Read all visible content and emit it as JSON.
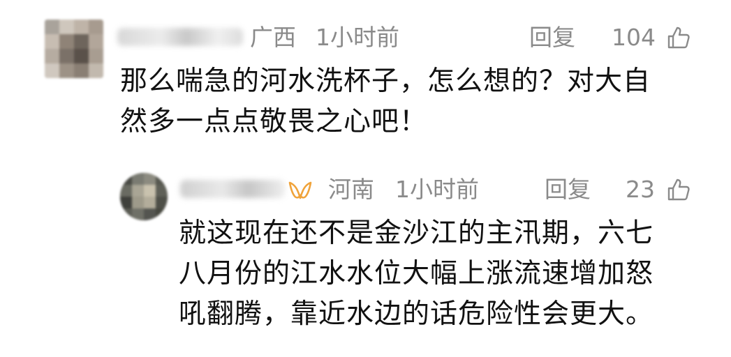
{
  "comments": {
    "main": {
      "location": "广西",
      "time": "1小时前",
      "reply_label": "回复",
      "likes": "104",
      "text_lines": [
        "那么喘急的河水洗杯子，怎么想的？对大自",
        "然多一点点敬畏之心吧！"
      ]
    },
    "reply": {
      "location": "河南",
      "time": "1小时前",
      "reply_label": "回复",
      "likes": "23",
      "text_lines": [
        "就这现在还不是金沙江的主汛期，六七",
        "八月份的江水水位大幅上涨流速增加怒",
        "吼翻腾，靠近水边的话危险性会更大。"
      ]
    }
  },
  "colors": {
    "text": "#111111",
    "meta": "#8a8a8a",
    "badge": "#f0a33a"
  },
  "icons": {
    "like": "thumbs-up-icon",
    "badge": "vip-badge-icon"
  }
}
